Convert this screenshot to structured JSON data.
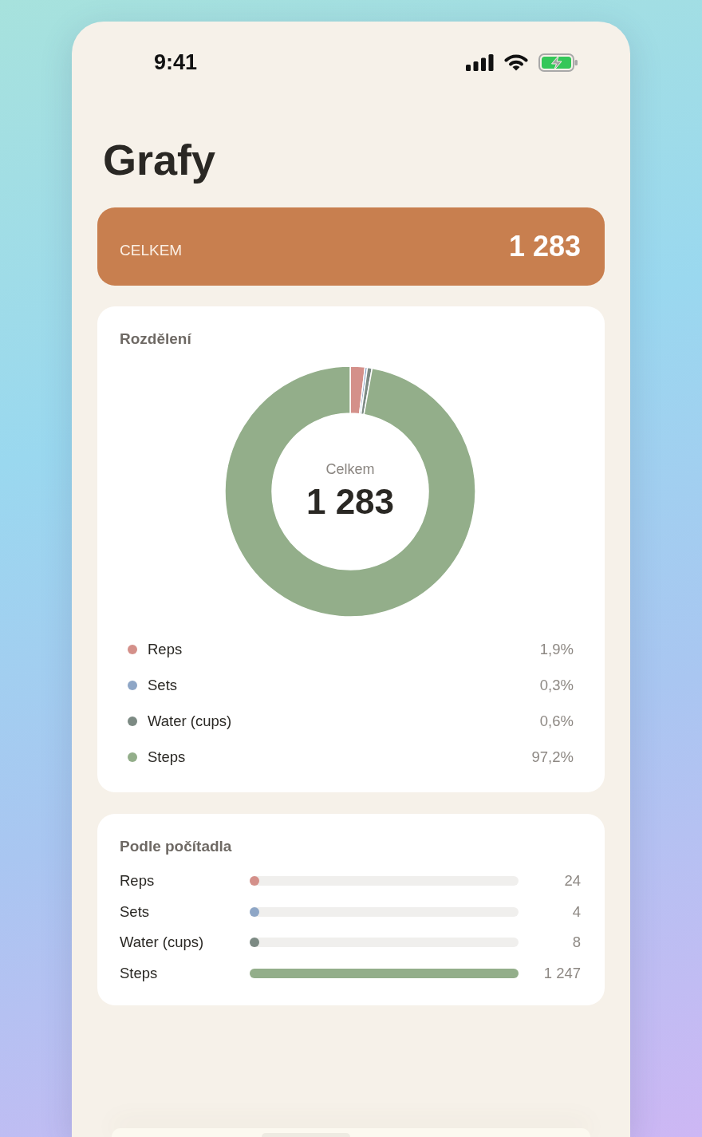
{
  "status_bar": {
    "time": "9:41"
  },
  "title": "Grafy",
  "total": {
    "label": "CELKEM",
    "value": "1 283"
  },
  "distribution": {
    "title": "Rozdělení",
    "center_label": "Celkem",
    "center_value": "1 283",
    "chart_data": {
      "type": "donut",
      "categories": [
        "Reps",
        "Sets",
        "Water (cups)",
        "Steps"
      ],
      "values": [
        1.9,
        0.3,
        0.6,
        97.2
      ]
    },
    "legend": [
      {
        "color": "#d4908a",
        "percent": "1,9%"
      },
      {
        "color": "#8ea6c6",
        "percent": "0,3%"
      },
      {
        "color": "#7c8a83",
        "percent": "0,6%"
      },
      {
        "color": "#93ae8a",
        "percent": "97,2%"
      }
    ]
  },
  "counters": {
    "title": "Podle počítadla",
    "rows": [
      {
        "name": "Reps",
        "color": "#d4908a",
        "level": 0.019,
        "value": "24"
      },
      {
        "name": "Sets",
        "color": "#8ea6c6",
        "level": 0.003,
        "value": "4"
      },
      {
        "name": "Water (cups)",
        "color": "#7c8a83",
        "level": 0.006,
        "value": "8"
      },
      {
        "name": "Steps",
        "color": "#93ae8a",
        "level": 1,
        "value": "1 247"
      }
    ]
  }
}
